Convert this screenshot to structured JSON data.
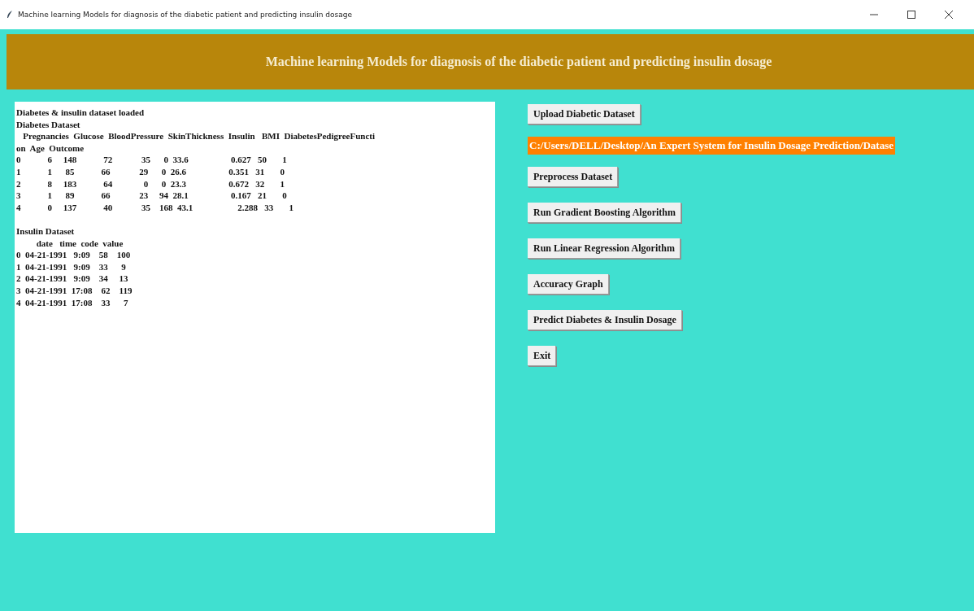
{
  "window": {
    "title": "Machine learning Models for diagnosis of the diabetic patient and predicting insulin dosage"
  },
  "header": {
    "title": "Machine learning Models for diagnosis of the diabetic patient and predicting insulin dosage"
  },
  "output": {
    "sections": [
      {
        "lines": [
          "Diabetes & insulin dataset loaded",
          "Diabetes Dataset",
          "   Pregnancies  Glucose  BloodPressure  SkinThickness  Insulin   BMI  DiabetesPedigreeFuncti",
          "on  Age  Outcome",
          "0            6     148            72             35      0  33.6                   0.627   50       1",
          "1            1      85            66             29      0  26.6                   0.351   31       0",
          "2            8     183            64              0      0  23.3                   0.672   32       1",
          "3            1      89            66             23     94  28.1                   0.167   21       0",
          "4            0     137            40             35    168  43.1                    2.288   33       1"
        ]
      },
      {
        "lines": [
          "Insulin Dataset",
          "         date   time  code  value",
          "0  04-21-1991   9:09    58    100",
          "1  04-21-1991   9:09    33      9",
          "2  04-21-1991   9:09    34     13",
          "3  04-21-1991  17:08    62    119",
          "4  04-21-1991  17:08    33      7"
        ]
      }
    ]
  },
  "controls": [
    {
      "kind": "button",
      "label": "Upload Diabetic Dataset"
    },
    {
      "kind": "path",
      "label": "C:/Users/DELL/Desktop/An Expert System for Insulin Dosage Prediction/Datase"
    },
    {
      "kind": "button",
      "label": "Preprocess Dataset"
    },
    {
      "kind": "button",
      "label": "Run Gradient Boosting Algorithm"
    },
    {
      "kind": "button",
      "label": "Run Linear Regression Algorithm"
    },
    {
      "kind": "button",
      "label": "Accuracy Graph"
    },
    {
      "kind": "button",
      "label": "Predict Diabetes & Insulin Dosage"
    },
    {
      "kind": "button",
      "label": "Exit"
    }
  ]
}
